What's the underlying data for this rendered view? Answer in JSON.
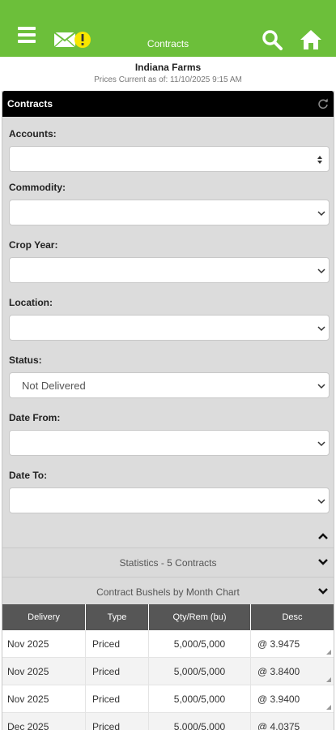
{
  "header": {
    "title": "Contracts",
    "icons": [
      "menu-icon",
      "message-alert-icon",
      "search-icon",
      "home-icon"
    ],
    "bg_color": "#6cbf3a"
  },
  "farm": {
    "name": "Indiana Farms",
    "prices_current": "Prices Current as of: 11/10/2025 9:15 AM"
  },
  "panel": {
    "title": "Contracts"
  },
  "filters": {
    "accounts": {
      "label": "Accounts:",
      "value": ""
    },
    "commodity": {
      "label": "Commodity:",
      "value": ""
    },
    "crop_year": {
      "label": "Crop Year:",
      "value": ""
    },
    "location": {
      "label": "Location:",
      "value": ""
    },
    "status": {
      "label": "Status:",
      "value": "Not Delivered"
    },
    "date_from": {
      "label": "Date From:",
      "value": ""
    },
    "date_to": {
      "label": "Date To:",
      "value": ""
    }
  },
  "sections": {
    "statistics": "Statistics - 5 Contracts",
    "chart": "Contract Bushels by Month Chart"
  },
  "table": {
    "headers": [
      "Delivery",
      "Type",
      "Qty/Rem (bu)",
      "Desc"
    ],
    "rows": [
      {
        "delivery": "Nov 2025",
        "type": "Priced",
        "qty": "5,000/5,000",
        "desc": "@ 3.9475"
      },
      {
        "delivery": "Nov 2025",
        "type": "Priced",
        "qty": "5,000/5,000",
        "desc": "@ 3.8400"
      },
      {
        "delivery": "Nov 2025",
        "type": "Priced",
        "qty": "5,000/5,000",
        "desc": "@ 3.9400"
      },
      {
        "delivery": "Dec 2025",
        "type": "Priced",
        "qty": "5,000/5,000",
        "desc": "@ 4.0375"
      }
    ]
  }
}
